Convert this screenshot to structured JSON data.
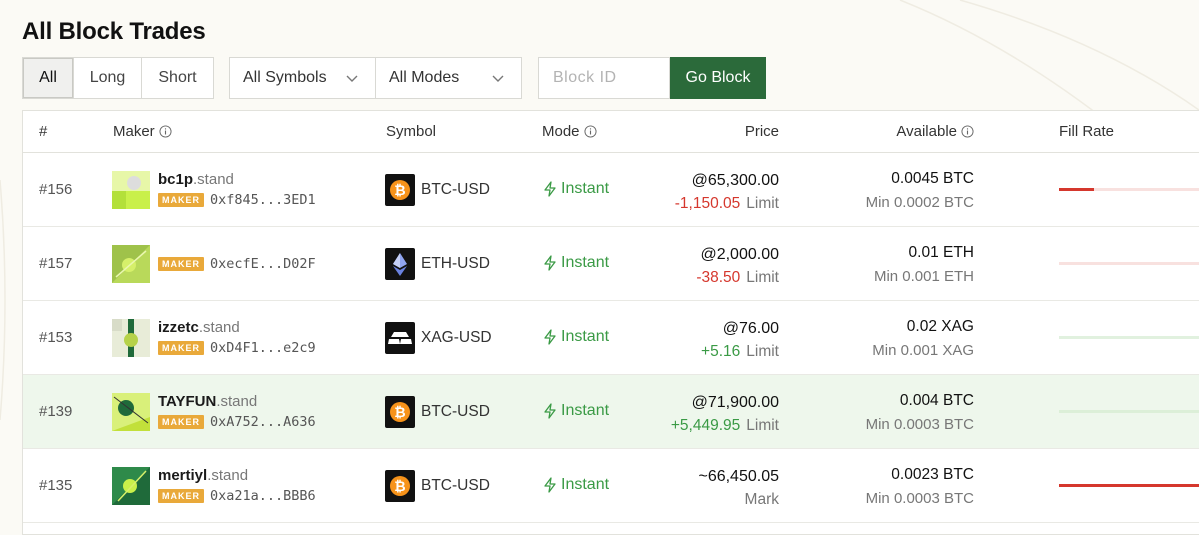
{
  "page": {
    "title": "All Block Trades"
  },
  "filters": {
    "sides": [
      {
        "label": "All",
        "active": true
      },
      {
        "label": "Long",
        "active": false
      },
      {
        "label": "Short",
        "active": false
      }
    ],
    "symbols_select": "All Symbols",
    "modes_select": "All Modes",
    "block_id_placeholder": "Block ID",
    "go_label": "Go Block"
  },
  "table": {
    "headers": {
      "index": "#",
      "maker": "Maker",
      "symbol": "Symbol",
      "mode": "Mode",
      "price": "Price",
      "available": "Available",
      "fill_rate": "Fill Rate"
    },
    "maker_badge": "MAKER",
    "rows": [
      {
        "index": "#156",
        "maker_name": "bc1p",
        "maker_suffix": ".stand",
        "address": "0xf845...3ED1",
        "symbol": "BTC-USD",
        "symbol_icon": "bitcoin-icon",
        "mode": "Instant",
        "price": "@65,300.00",
        "price_delta": "-1,150.05",
        "price_delta_sign": "neg",
        "price_type": "Limit",
        "available": "0.0045 BTC",
        "min": "Min 0.0002 BTC",
        "fill_rate": 0.25,
        "fill_color": "#d5372d",
        "track_color": "#f8e1df",
        "highlight": false
      },
      {
        "index": "#157",
        "maker_name": "",
        "maker_suffix": "",
        "address": "0xecfE...D02F",
        "symbol": "ETH-USD",
        "symbol_icon": "ethereum-icon",
        "mode": "Instant",
        "price": "@2,000.00",
        "price_delta": "-38.50",
        "price_delta_sign": "neg",
        "price_type": "Limit",
        "available": "0.01 ETH",
        "min": "Min 0.001 ETH",
        "fill_rate": 0,
        "fill_color": "#d5372d",
        "track_color": "#f8e1df",
        "highlight": false
      },
      {
        "index": "#153",
        "maker_name": "izzetc",
        "maker_suffix": ".stand",
        "address": "0xD4F1...e2c9",
        "symbol": "XAG-USD",
        "symbol_icon": "silver-bars-icon",
        "mode": "Instant",
        "price": "@76.00",
        "price_delta": "+5.16",
        "price_delta_sign": "pos",
        "price_type": "Limit",
        "available": "0.02 XAG",
        "min": "Min 0.001 XAG",
        "fill_rate": 0,
        "fill_color": "#3a9a45",
        "track_color": "#e1f1df",
        "highlight": false
      },
      {
        "index": "#139",
        "maker_name": "TAYFUN",
        "maker_suffix": ".stand",
        "address": "0xA752...A636",
        "symbol": "BTC-USD",
        "symbol_icon": "bitcoin-icon",
        "mode": "Instant",
        "price": "@71,900.00",
        "price_delta": "+5,449.95",
        "price_delta_sign": "pos",
        "price_type": "Limit",
        "available": "0.004 BTC",
        "min": "Min 0.0003 BTC",
        "fill_rate": 0,
        "fill_color": "#3a9a45",
        "track_color": "#dcefd8",
        "highlight": true
      },
      {
        "index": "#135",
        "maker_name": "mertiyl",
        "maker_suffix": ".stand",
        "address": "0xa21a...BBB6",
        "symbol": "BTC-USD",
        "symbol_icon": "bitcoin-icon",
        "mode": "Instant",
        "price": "~66,450.05",
        "price_delta": "",
        "price_delta_sign": "",
        "price_type": "Mark",
        "available": "0.0023 BTC",
        "min": "Min 0.0003 BTC",
        "fill_rate": 1,
        "fill_color": "#d5372d",
        "track_color": "#f8e1df",
        "highlight": false
      }
    ]
  }
}
